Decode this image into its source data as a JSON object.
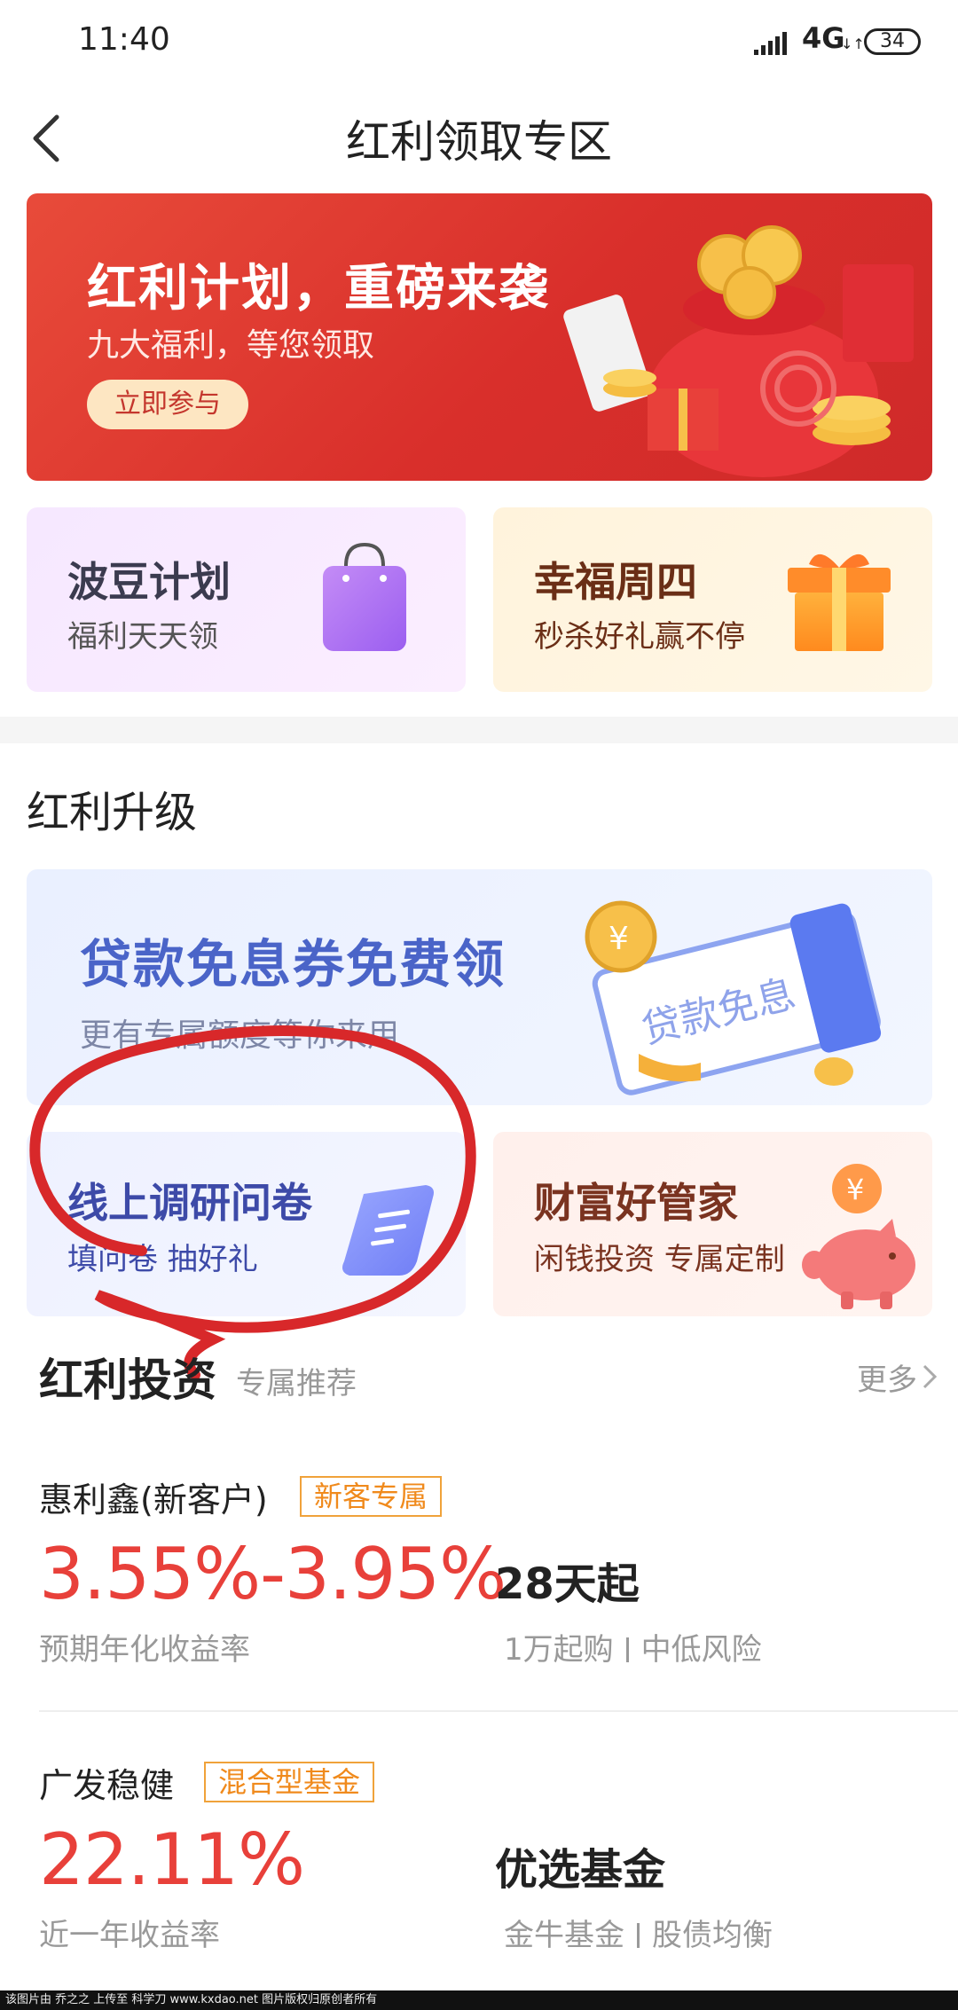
{
  "status_bar": {
    "time": "11:40",
    "network": "4G",
    "network_arrows": "↓↑",
    "battery": "34"
  },
  "nav": {
    "title": "红利领取专区"
  },
  "hero": {
    "title": "红利计划，重磅来袭",
    "subtitle": "九大福利，等您领取",
    "button": "立即参与"
  },
  "cards_top": [
    {
      "title": "波豆计划",
      "subtitle": "福利天天领",
      "icon": "shopping-bag-icon"
    },
    {
      "title": "幸福周四",
      "subtitle": "秒杀好礼赢不停",
      "icon": "gift-box-icon"
    }
  ],
  "upgrade_section": {
    "title": "红利升级"
  },
  "loan_banner": {
    "title": "贷款免息券免费领",
    "subtitle": "更有专属额度等你来用",
    "ticket_text": "贷款免息"
  },
  "cards_bottom": [
    {
      "title": "线上调研问卷",
      "subtitle": "填问卷 抽好礼",
      "icon": "scroll-icon"
    },
    {
      "title": "财富好管家",
      "subtitle": "闲钱投资 专属定制",
      "icon": "piggy-bank-icon",
      "coin_symbol": "¥"
    }
  ],
  "invest": {
    "title": "红利投资",
    "subtitle": "专属推荐",
    "more": "更多"
  },
  "products": [
    {
      "name": "惠利鑫(新客户)",
      "tag": "新客专属",
      "rate": "3.55%-3.95%",
      "rate_label": "预期年化收益率",
      "term": "28天起",
      "detail_a": "1万起购",
      "detail_b": "中低风险"
    },
    {
      "name": "广发稳健",
      "tag": "混合型基金",
      "rate": "22.11%",
      "rate_label": "近一年收益率",
      "term": "优选基金",
      "detail_a": "金牛基金",
      "detail_b": "股债均衡"
    }
  ],
  "watermark": "该图片由 乔之之 上传至 科学刀 www.kxdao.net 图片版权归原创者所有",
  "colors": {
    "accent_red": "#e8403a",
    "tag_orange": "#f08a1c",
    "hero_red": "#d92f2b"
  }
}
